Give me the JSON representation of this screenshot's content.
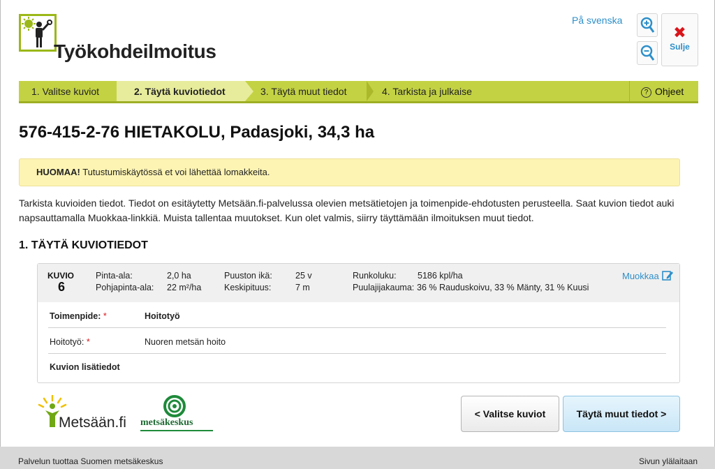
{
  "header": {
    "app_title": "Työkohdeilmoitus",
    "language_link": "På svenska",
    "close_label": "Sulje"
  },
  "steps": [
    {
      "label": "1. Valitse kuviot",
      "active": false
    },
    {
      "label": "2. Täytä kuviotiedot",
      "active": true
    },
    {
      "label": "3. Täytä muut tiedot",
      "active": false
    },
    {
      "label": "4. Tarkista ja julkaise",
      "active": false
    }
  ],
  "help_label": "Ohjeet",
  "page_title": "576-415-2-76 HIETAKOLU, Padasjoki, 34,3 ha",
  "notice": {
    "strong": "HUOMAA!",
    "text": " Tutustumiskäytössä et voi lähettää lomakkeita."
  },
  "intro": "Tarkista kuvioiden tiedot. Tiedot on esitäytetty Metsään.fi-palvelussa olevien metsätietojen ja toimenpide-ehdotusten perusteella. Saat kuvion tiedot auki napsauttamalla Muokkaa-linkkiä. Muista tallentaa muutokset. Kun olet valmis, siirry täyttämään ilmoituksen muut tiedot.",
  "section_title": "1.  TÄYTÄ KUVIOTIEDOT",
  "stand": {
    "label": "KUVIO",
    "number": "6",
    "area_label": "Pinta-ala:",
    "area_value": "2,0 ha",
    "basal_label": "Pohjapinta-ala:",
    "basal_value": "22 m²/ha",
    "age_label": "Puuston ikä:",
    "age_value": "25 v",
    "height_label": "Keskipituus:",
    "height_value": "7 m",
    "stem_label": "Runkoluku:",
    "stem_value": "5186 kpl/ha",
    "species_label": "Puulajijakauma:",
    "species_value": "36 % Rauduskoivu, 33 % Mänty, 31 % Kuusi",
    "edit_label": "Muokkaa"
  },
  "details": {
    "operation_label": "Toimenpide:",
    "operation_value": "Hoitotyö",
    "work_label": "Hoitotyö:",
    "work_value": "Nuoren metsän hoito",
    "extra_label": "Kuvion lisätiedot",
    "required_mark": "*"
  },
  "brands": {
    "metsaan": "Metsään.fi",
    "metsakeskus": "metsäkeskus"
  },
  "buttons": {
    "back": "< Valitse kuviot",
    "next": "Täytä muut tiedot >"
  },
  "footer": {
    "left": "Palvelun tuottaa Suomen metsäkeskus",
    "right": "Sivun ylälaitaan"
  },
  "colors": {
    "accent_green": "#c3d243",
    "active_step": "#e7ec9c",
    "link_blue": "#2d8fc9",
    "close_red": "#d9161b",
    "notice_bg": "#fdf4b3"
  }
}
